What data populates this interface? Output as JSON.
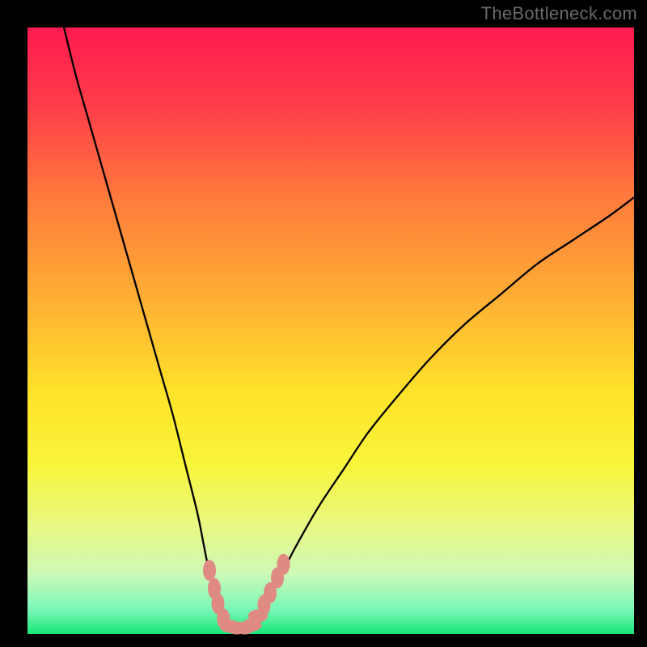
{
  "watermark": "TheBottleneck.com",
  "chart_data": {
    "type": "line",
    "title": "",
    "xlabel": "",
    "ylabel": "",
    "xlim": [
      0,
      100
    ],
    "ylim": [
      0,
      100
    ],
    "background_gradient": {
      "stops": [
        {
          "offset": 0.0,
          "color": "#ff1a4f"
        },
        {
          "offset": 0.12,
          "color": "#ff3a4a"
        },
        {
          "offset": 0.28,
          "color": "#ff7a3c"
        },
        {
          "offset": 0.45,
          "color": "#ffb034"
        },
        {
          "offset": 0.6,
          "color": "#ffe22a"
        },
        {
          "offset": 0.72,
          "color": "#f8f53a"
        },
        {
          "offset": 0.82,
          "color": "#e8f882"
        },
        {
          "offset": 0.9,
          "color": "#cef9b6"
        },
        {
          "offset": 0.96,
          "color": "#7af7b8"
        },
        {
          "offset": 1.0,
          "color": "#18e676"
        }
      ]
    },
    "series": [
      {
        "name": "bottleneck-curve",
        "color": "#000000",
        "x": [
          6,
          8,
          10,
          12,
          14,
          16,
          18,
          20,
          22,
          24,
          26,
          28,
          29,
          30,
          31,
          32,
          33,
          34,
          35,
          36,
          37,
          38,
          40,
          42,
          44,
          48,
          52,
          56,
          60,
          66,
          72,
          78,
          84,
          90,
          96,
          100
        ],
        "y": [
          100,
          92,
          85,
          78,
          71,
          64,
          57,
          50,
          43,
          36,
          28,
          20,
          15,
          10,
          6,
          3,
          1.5,
          1,
          1,
          1,
          1.5,
          3,
          6,
          10,
          14,
          21,
          27,
          33,
          38,
          45,
          51,
          56,
          61,
          65,
          69,
          72
        ]
      }
    ],
    "markers": {
      "name": "highlighted-points",
      "color": "#e08a84",
      "points": [
        {
          "x": 30.0,
          "y": 10.5
        },
        {
          "x": 30.8,
          "y": 7.5
        },
        {
          "x": 31.4,
          "y": 5.0
        },
        {
          "x": 32.3,
          "y": 2.5
        },
        {
          "x": 33.3,
          "y": 1.3
        },
        {
          "x": 34.5,
          "y": 1.0
        },
        {
          "x": 35.8,
          "y": 1.0
        },
        {
          "x": 37.0,
          "y": 1.5
        },
        {
          "x": 38.0,
          "y": 3.0
        },
        {
          "x": 39.0,
          "y": 4.8
        },
        {
          "x": 40.0,
          "y": 6.8
        },
        {
          "x": 41.2,
          "y": 9.3
        },
        {
          "x": 42.2,
          "y": 11.5
        }
      ]
    }
  }
}
